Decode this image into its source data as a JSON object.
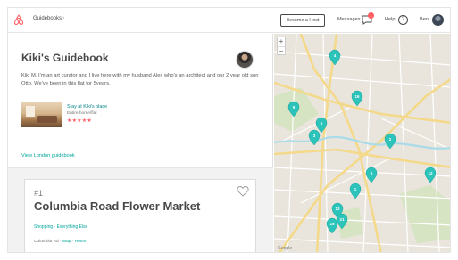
{
  "topbar": {
    "breadcrumb": "Guidebooks",
    "become_host": "Become a Host",
    "messages": "Messages",
    "messages_badge": "1",
    "help": "Help",
    "help_glyph": "?",
    "user": "Ben"
  },
  "guidebook": {
    "title": "Kiki's Guidebook",
    "description": "Kiki M. I'm an art curator and I live here with my husband Alex who's an architect and our 2 year old son Otto. We've been in this flat for 5years.",
    "stay": {
      "title": "Stay at Kiki's place",
      "subtitle": "Entire home/flat",
      "stars": "★★★★★"
    },
    "view_link": "View London guidebook"
  },
  "card": {
    "number": "#1",
    "title": "Columbia Road Flower Market",
    "tags": "Shopping · Everything Else",
    "location": "Columbia Rd",
    "map_link": "Map",
    "hours_link": "Hours"
  },
  "map": {
    "zoom_in": "+",
    "zoom_out": "−",
    "credit": "Google",
    "accent": "#2cc3bb",
    "water": "#a9dbe9",
    "park": "#cfe0b5",
    "pins": [
      "4",
      "9",
      "16",
      "5",
      "3",
      "2",
      "6",
      "12",
      "1",
      "13",
      "21",
      "15"
    ]
  },
  "colors": {
    "brand": "#ff5a5f",
    "link": "#00a699"
  }
}
